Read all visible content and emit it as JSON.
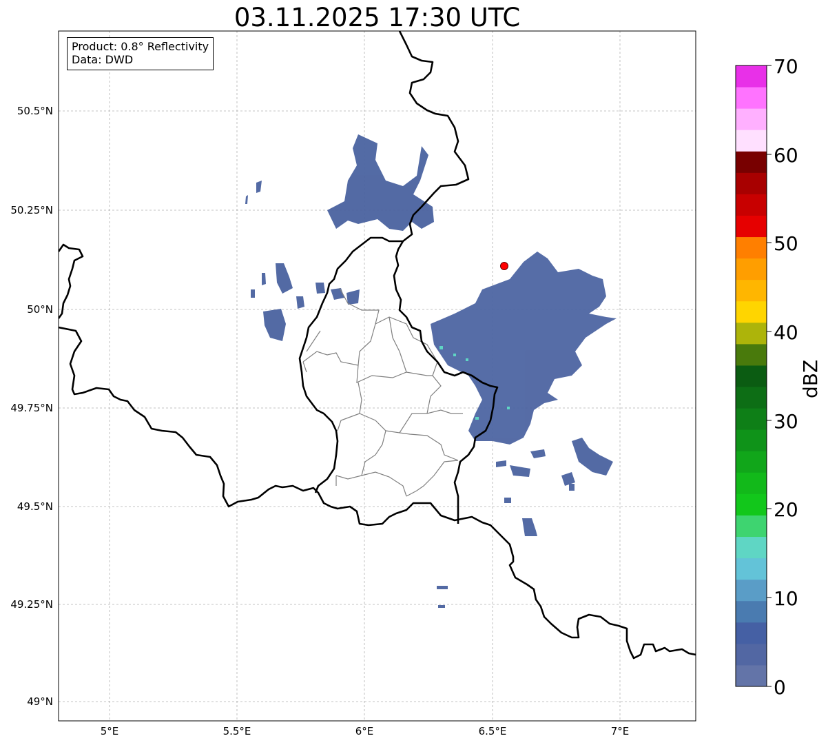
{
  "title": "03.11.2025 17:30 UTC",
  "info": {
    "product_line": "Product: 0.8° Reflectivity",
    "data_line": "Data: DWD"
  },
  "axes": {
    "lon_ticks": [
      "5°E",
      "5.5°E",
      "6°E",
      "6.5°E",
      "7°E"
    ],
    "lat_ticks": [
      "50.5°N",
      "50.25°N",
      "50°N",
      "49.75°N",
      "49.5°N",
      "49.25°N",
      "49°N"
    ]
  },
  "colorbar": {
    "label": "dBZ",
    "tick_labels": [
      "0",
      "10",
      "20",
      "30",
      "40",
      "50",
      "60",
      "70"
    ],
    "colors": [
      "#6374a8",
      "#5267a3",
      "#4560a4",
      "#4a7bb0",
      "#5a9dc7",
      "#63c3d8",
      "#5fd6c4",
      "#3ed470",
      "#12c71b",
      "#12b91a",
      "#11a61a",
      "#0f9319",
      "#0e7f17",
      "#0d6e15",
      "#0b5c12",
      "#497a0c",
      "#adb40a",
      "#ffd500",
      "#ffb600",
      "#ff9e00",
      "#ff7f00",
      "#e60000",
      "#c80000",
      "#a80000",
      "#780000",
      "#ffe0ff",
      "#ffb0ff",
      "#ff73ff",
      "#e830e8"
    ]
  },
  "markers": [
    {
      "name": "radar-site",
      "lon": 6.55,
      "lat": 50.11,
      "color": "#ff0000"
    }
  ]
}
